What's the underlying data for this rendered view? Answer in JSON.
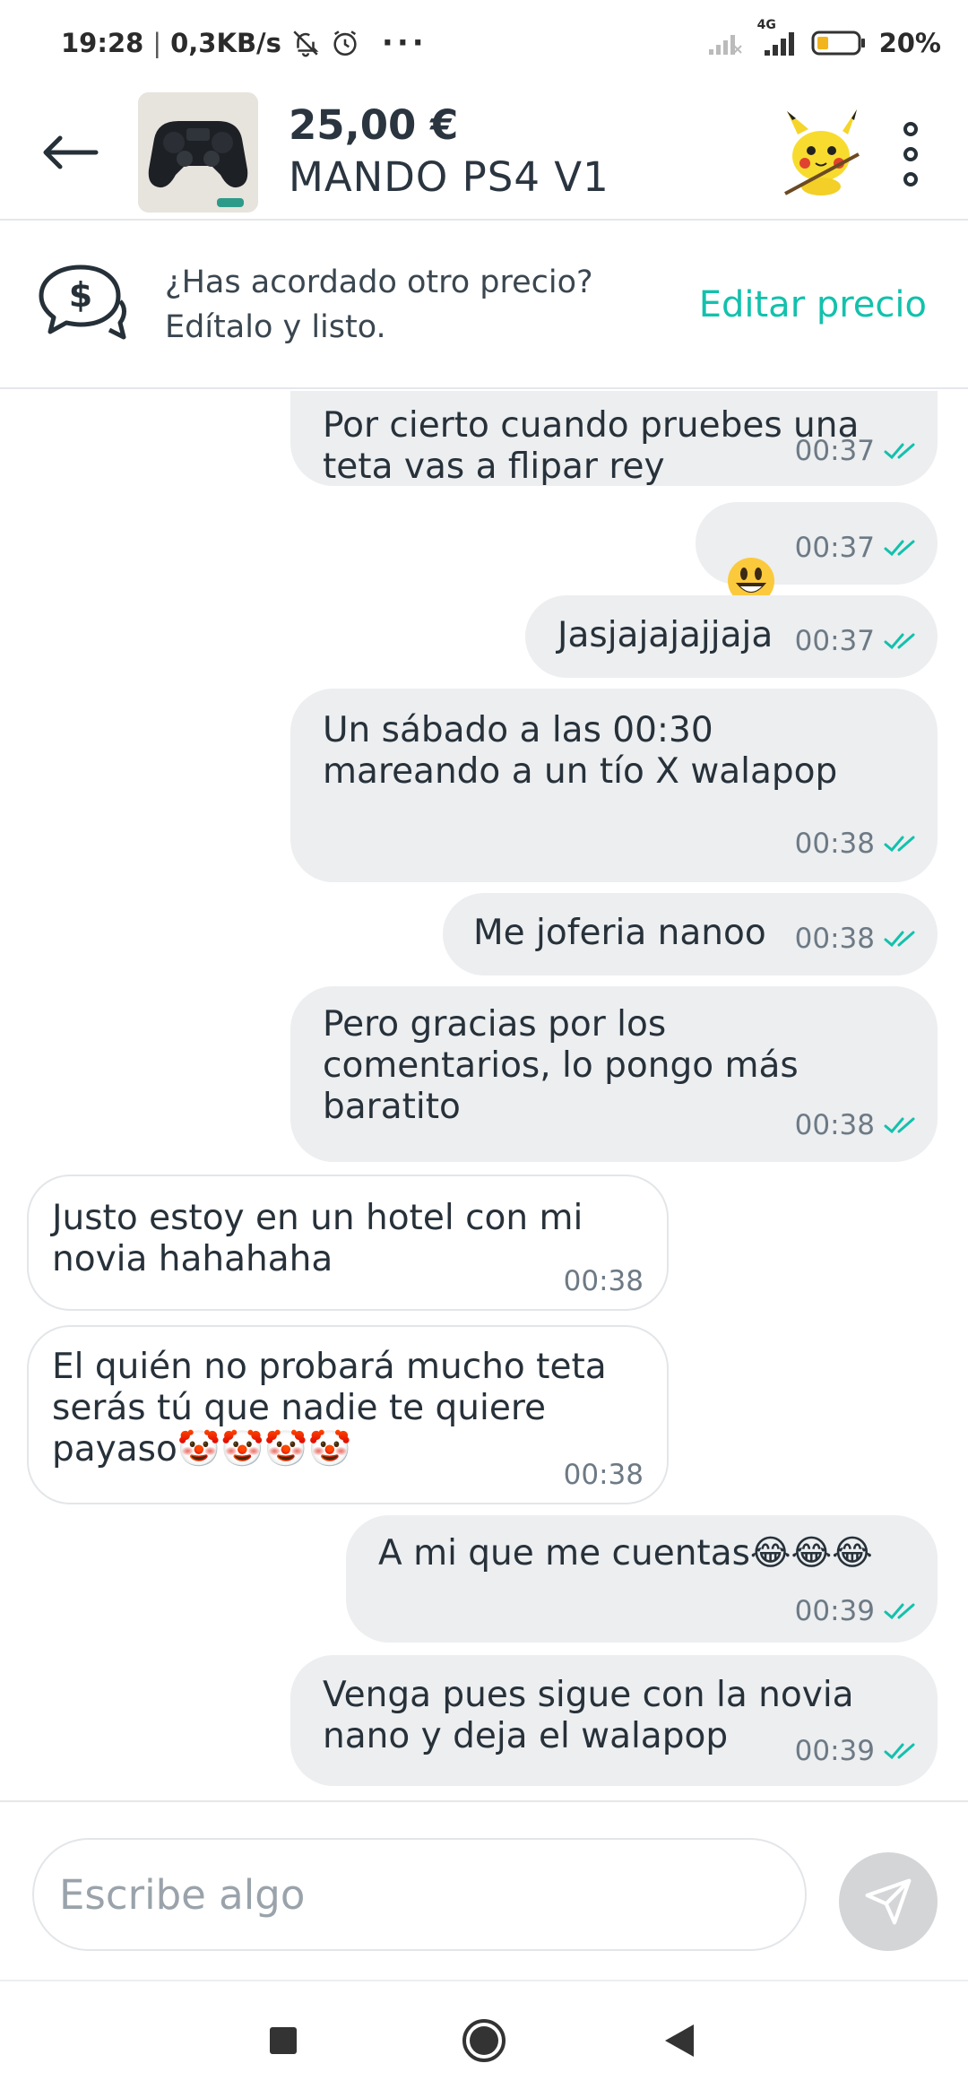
{
  "status_bar": {
    "time": "19:28",
    "separator": "|",
    "speed": "0,3KB/s",
    "dots": "···",
    "battery": "20%",
    "network": "4G",
    "icons": [
      "bell-off-icon",
      "alarm-icon",
      "signal-icon",
      "battery-icon"
    ]
  },
  "header": {
    "price": "25,00 €",
    "title": "MANDO PS4 V1",
    "icons": [
      "back-arrow-icon",
      "more-vertical-icon"
    ]
  },
  "banner": {
    "line1": "¿Has acordado otro precio?",
    "line2": "Edítalo y listo.",
    "action": "Editar precio",
    "icon": "price-chat-icon",
    "accent": "#13c1ac"
  },
  "chat": {
    "messages": [
      {
        "from": "me",
        "text": "Por cierto cuando pruebes una\nteta vas a flipar rey",
        "time": "00:37"
      },
      {
        "from": "me",
        "text": "😃",
        "time": "00:37"
      },
      {
        "from": "me",
        "text": "Jasjajajajjaja",
        "time": "00:37"
      },
      {
        "from": "me",
        "text": "Un sábado a las 00:30\nmareando a un tío X walapop",
        "time": "00:38"
      },
      {
        "from": "me",
        "text": "Me joferia nanoo",
        "time": "00:38"
      },
      {
        "from": "me",
        "text": "Pero gracias por los\ncomentarios, lo pongo más\nbaratito",
        "time": "00:38"
      },
      {
        "from": "them",
        "text": "Justo estoy en un hotel con mi\nnovia hahahaha",
        "time": "00:38"
      },
      {
        "from": "them",
        "text": "El quién no probará mucho teta\nserás tú que nadie te quiere\npayaso🤡🤡🤡🤡",
        "time": "00:38"
      },
      {
        "from": "me",
        "text": "A mi que me cuentas😂😂😂",
        "time": "00:39"
      },
      {
        "from": "me",
        "text": "Venga pues sigue con la novia\nnano y deja el walapop",
        "time": "00:39"
      }
    ]
  },
  "composer": {
    "placeholder": "Escribe algo",
    "value": "",
    "icons": [
      "send-icon"
    ]
  },
  "nav_bar": {
    "icons": [
      "recents-square-icon",
      "home-circle-icon",
      "back-triangle-icon"
    ]
  },
  "colors": {
    "accent": "#13c1ac",
    "outgoing_bubble": "#eceef0",
    "incoming_border": "#e3e6e9",
    "text": "#27313a",
    "ticks": "#13c1ac"
  }
}
